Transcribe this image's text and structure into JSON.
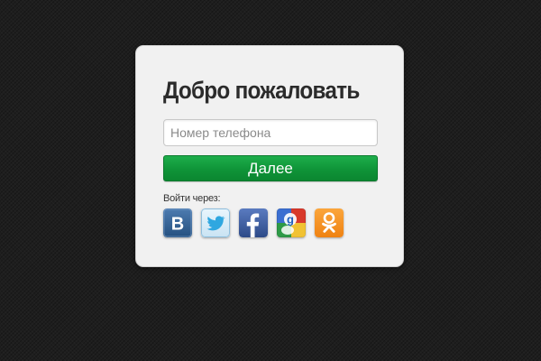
{
  "login": {
    "title": "Добро пожаловать",
    "phone_placeholder": "Номер телефона",
    "phone_value": "",
    "next_label": "Далее",
    "login_via_label": "Войти через:",
    "accent_color": "#109a3c",
    "social": [
      {
        "name": "vkontakte",
        "icon": "vk-icon",
        "color": "#2f5c8e"
      },
      {
        "name": "twitter",
        "icon": "twitter-icon",
        "color": "#4aa6dc"
      },
      {
        "name": "facebook",
        "icon": "facebook-icon",
        "color": "#3a5a98"
      },
      {
        "name": "google",
        "icon": "google-icon",
        "color": "#f0c52b"
      },
      {
        "name": "odnoklassniki",
        "icon": "odnoklassniki-icon",
        "color": "#f7931e"
      }
    ]
  }
}
